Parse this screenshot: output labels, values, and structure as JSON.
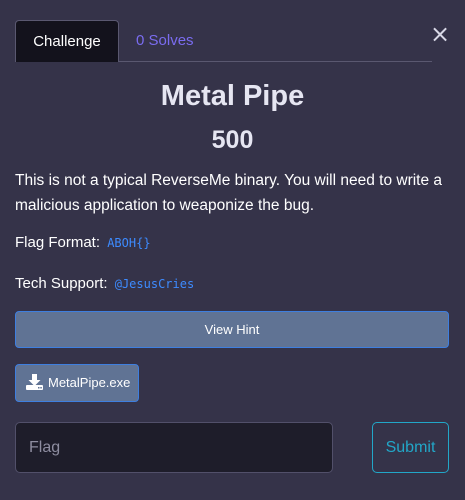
{
  "tabs": {
    "challenge_label": "Challenge",
    "solves_label": "0 Solves"
  },
  "close_glyph": "×",
  "challenge": {
    "name": "Metal Pipe",
    "value": "500",
    "description": "This is not a typical ReverseMe binary. You will need to write a malicious application to weaponize the bug.",
    "flag_format_label": "Flag Format:",
    "flag_format_value": "ABOH{}",
    "tech_support_label": "Tech Support:",
    "tech_support_value": "@JesusCries"
  },
  "buttons": {
    "hint_label": "View Hint",
    "file_label": "MetalPipe.exe",
    "file_icon": "download-icon",
    "submit_label": "Submit"
  },
  "flag_input": {
    "placeholder": "Flag",
    "value": ""
  },
  "colors": {
    "background": "#353349",
    "accent_purple": "#7a6cf0",
    "code_blue": "#3d8bff",
    "button_fill": "#607394",
    "submit_cyan": "#22a7c8"
  }
}
